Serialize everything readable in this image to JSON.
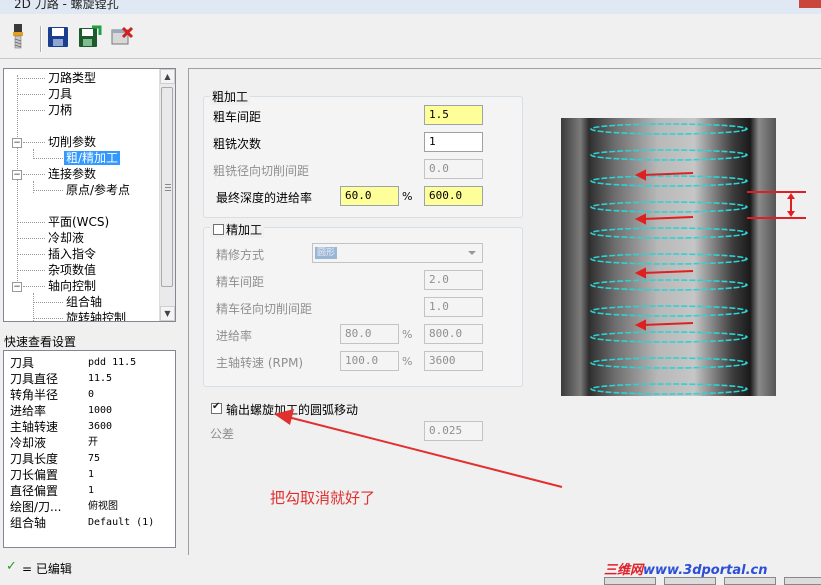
{
  "window": {
    "title": "2D 刀路 - 螺旋镗孔"
  },
  "toolbar": {
    "icons": [
      "tool-icon",
      "save-icon",
      "save-as-icon",
      "cancel-icon"
    ]
  },
  "tree": {
    "items": [
      {
        "label": "刀路类型"
      },
      {
        "label": "刀具"
      },
      {
        "label": "刀柄"
      },
      {
        "label": ""
      },
      {
        "label": "切削参数",
        "expander": "−"
      },
      {
        "label": "粗/精加工"
      },
      {
        "label": "连接参数",
        "expander": "−"
      },
      {
        "label": "原点/参考点"
      },
      {
        "label": ""
      },
      {
        "label": "平面(WCS)"
      },
      {
        "label": "冷却液"
      },
      {
        "label": "插入指令"
      },
      {
        "label": "杂项数值"
      },
      {
        "label": "轴向控制",
        "expander": "−"
      },
      {
        "label": "组合轴"
      },
      {
        "label": "旋转轴控制"
      }
    ]
  },
  "quickview": {
    "title": "快速查看设置",
    "rows": [
      {
        "k": "刀具",
        "v": "pdd 11.5"
      },
      {
        "k": "刀具直径",
        "v": "11.5"
      },
      {
        "k": "转角半径",
        "v": "0"
      },
      {
        "k": "进给率",
        "v": "1000"
      },
      {
        "k": "主轴转速",
        "v": "3600"
      },
      {
        "k": "冷却液",
        "v": "开"
      },
      {
        "k": "刀具长度",
        "v": "75"
      },
      {
        "k": "刀长偏置",
        "v": "1"
      },
      {
        "k": "直径偏置",
        "v": "1"
      },
      {
        "k": "绘图/刀...",
        "v": "俯视图"
      },
      {
        "k": "组合轴",
        "v": "Default (1)"
      }
    ]
  },
  "status": {
    "check": "✓",
    "text": "= 已编辑"
  },
  "rough": {
    "title": "粗加工",
    "step_label": "粗车间距",
    "step_value": "1.5",
    "passes_label": "粗铣次数",
    "passes_value": "1",
    "radial_label": "粗铣径向切削间距",
    "radial_value": "0.0",
    "final_feed_label": "最终深度的进给率",
    "final_feed_pct": "60.0",
    "pct_sign": "%",
    "final_feed_value": "600.0"
  },
  "finish": {
    "title": "精加工",
    "enabled": false,
    "method_label": "精修方式",
    "method_value": "圆形",
    "step_label": "精车间距",
    "step_value": "2.0",
    "radial_label": "精车径向切削间距",
    "radial_value": "1.0",
    "feed_label": "进给率",
    "feed_pct": "80.0",
    "feed_value": "800.0",
    "spindle_label": "主轴转速 (RPM)",
    "spindle_pct": "100.0",
    "spindle_value": "3600"
  },
  "arc": {
    "label": "输出螺旋加工的圆弧移动",
    "checked": true,
    "tolerance_label": "公差",
    "tolerance_value": "0.025"
  },
  "annotation": {
    "text": "把勾取消就好了",
    "color": "#e03030"
  },
  "watermark": {
    "part_a": "三维网",
    "part_b": "www.3dportal.cn"
  },
  "colors": {
    "helix": "#2bd3d3",
    "arrow": "#e02020",
    "selection": "#3399ff",
    "highlight_field": "#ffff99"
  }
}
